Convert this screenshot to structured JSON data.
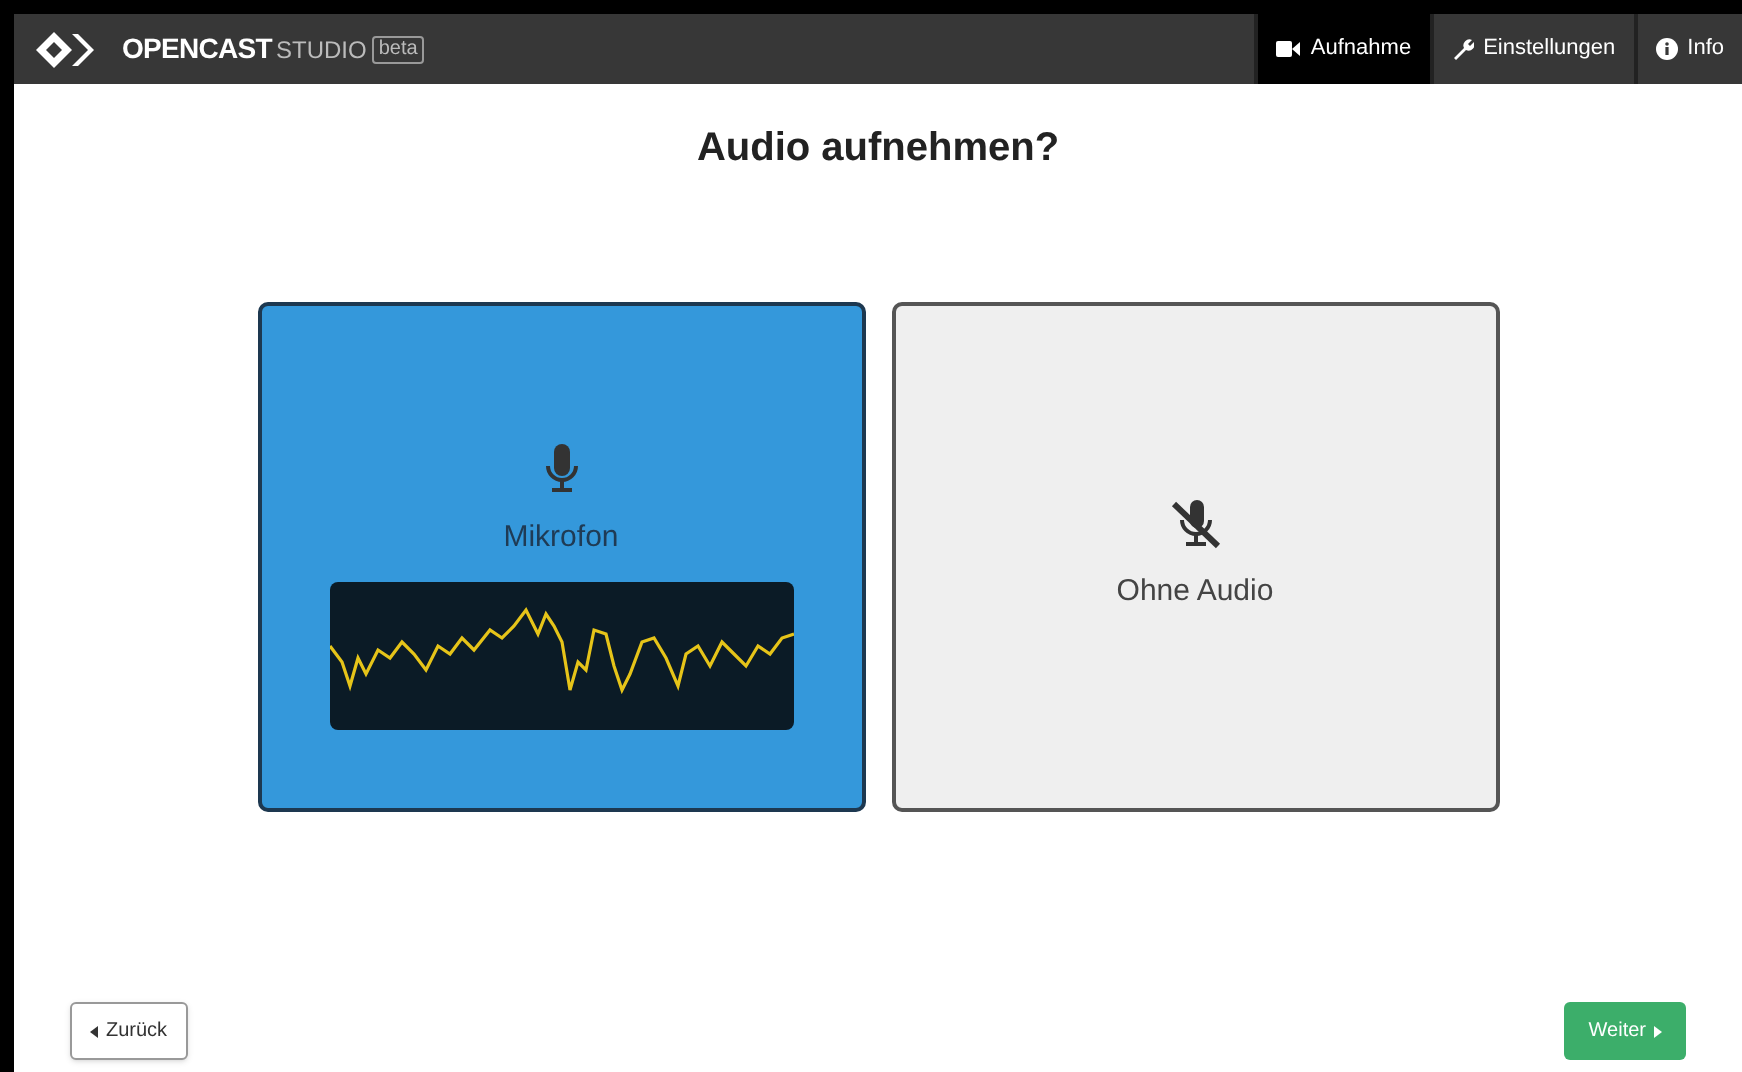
{
  "header": {
    "brand": "OPENCAST",
    "product": "STUDIO",
    "badge": "beta"
  },
  "nav": [
    {
      "label": "Aufnahme",
      "kind": "camera",
      "selected": true
    },
    {
      "label": "Einstellungen",
      "kind": "wrench",
      "selected": false
    },
    {
      "label": "Info",
      "kind": "info",
      "selected": false
    }
  ],
  "title": "Audio aufnehmen?",
  "options": [
    {
      "label": "Mikrofon",
      "kind": "microphone",
      "selected": true
    },
    {
      "label": "Ohne Audio",
      "kind": "none",
      "selected": false
    }
  ],
  "buttons": [
    {
      "label": "Zurück",
      "kind": "back"
    },
    {
      "label": "Weiter",
      "kind": "next"
    }
  ]
}
